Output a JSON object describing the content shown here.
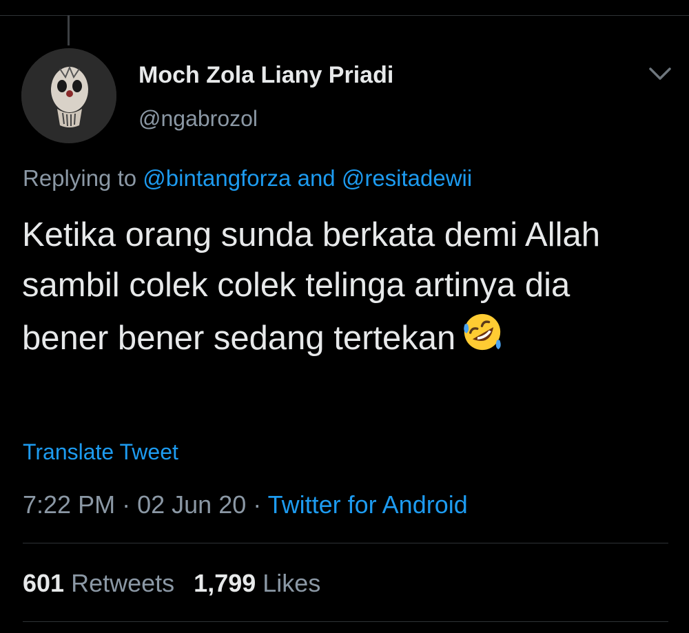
{
  "tweet": {
    "author": {
      "display_name": "Moch Zola Liany Priadi",
      "handle": "@ngabrozol"
    },
    "menu_icon": "chevron-down-icon",
    "reply": {
      "prefix": "Replying to",
      "mention_1": "@bintangforza",
      "joiner": "and",
      "mention_2": "@resitadewii"
    },
    "text": "Ketika orang sunda berkata demi Allah sambil colek colek telinga artinya dia bener bener sedang tertekan",
    "emoji": "rolling-on-the-floor-laughing-emoji",
    "translate_label": "Translate Tweet",
    "meta": {
      "time": "7:22 PM",
      "separator": "·",
      "date": "02 Jun 20",
      "source": "Twitter for Android"
    },
    "stats": {
      "retweets_count": "601",
      "retweets_label": "Retweets",
      "likes_count": "1,799",
      "likes_label": "Likes"
    }
  },
  "colors": {
    "background": "#000000",
    "text_primary": "#e7e9ea",
    "text_secondary": "#8b98a5",
    "accent": "#1d9bf0",
    "divider": "#2f3336"
  }
}
